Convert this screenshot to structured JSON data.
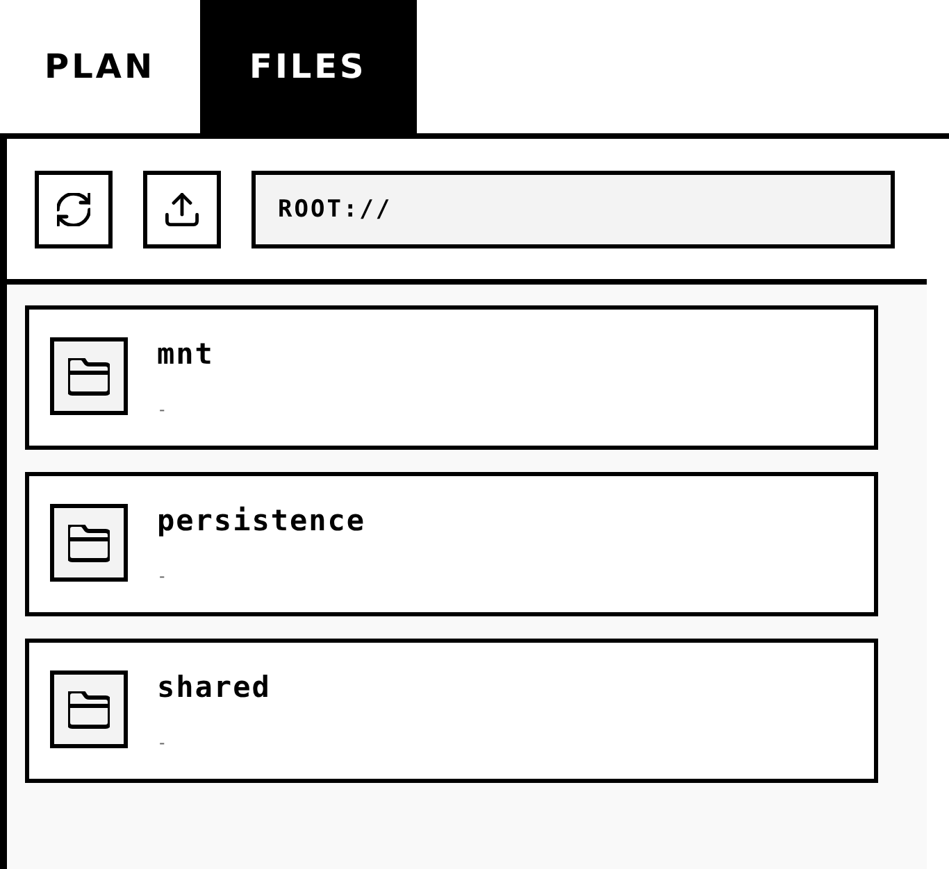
{
  "tabs": [
    {
      "label": "PLAN",
      "selected": false
    },
    {
      "label": "FILES",
      "selected": true
    }
  ],
  "toolbar": {
    "buttons": [
      {
        "kind": "refresh"
      },
      {
        "kind": "upload"
      }
    ],
    "path_field": {
      "value": "ROOT://"
    }
  },
  "files": [
    {
      "kind": "folder",
      "name": "mnt",
      "detail": "-"
    },
    {
      "kind": "folder",
      "name": "persistence",
      "detail": "-"
    },
    {
      "kind": "folder",
      "name": "shared",
      "detail": "-"
    }
  ]
}
